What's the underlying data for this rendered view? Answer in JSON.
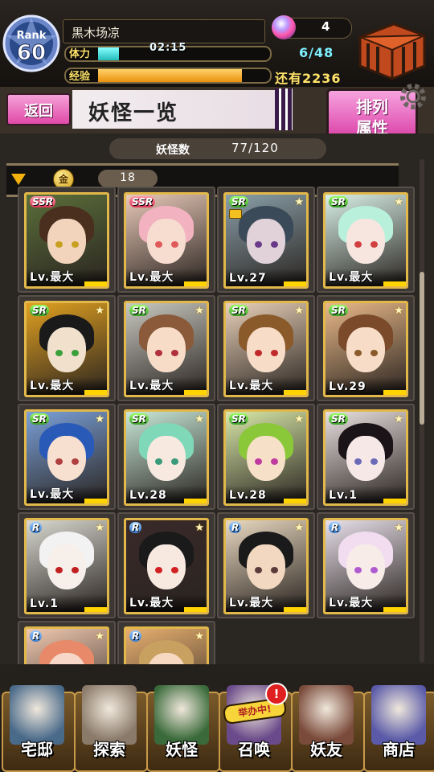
{
  "header": {
    "rank_label": "Rank",
    "rank_value": "60",
    "player_name": "黒木场凉",
    "stamina_label": "体力",
    "stamina_timer": "02:15",
    "stamina_value": "6/48",
    "stamina_fraction": 0.125,
    "exp_label": "经验",
    "exp_remaining": "还有2236",
    "exp_fraction": 0.87,
    "orb_count": "4"
  },
  "title_bar": {
    "back_label": "返回",
    "page_title": "妖怪一览",
    "sort_label_line1": "排列",
    "sort_label_line2": "属性"
  },
  "counts": {
    "label": "妖怪数",
    "value": "77/120",
    "coin_glyph": "金",
    "filter_count": "18"
  },
  "cards": [
    {
      "rarity": "SSR",
      "level": "Lv.最大",
      "hair": "#4a2f1f",
      "skin": "#f2d3bc",
      "eye": "#c8a020",
      "bg": "#5b6f3a",
      "locked": false
    },
    {
      "rarity": "SSR",
      "level": "Lv.最大",
      "hair": "#f2b2c0",
      "skin": "#f7dcd0",
      "eye": "#e05a5a",
      "bg": "#e8c9b8",
      "locked": false
    },
    {
      "rarity": "SR",
      "level": "Lv.27",
      "hair": "#3a4a58",
      "skin": "#e0d2d8",
      "eye": "#6a3a8a",
      "bg": "#8aa0aa",
      "locked": true
    },
    {
      "rarity": "SR",
      "level": "Lv.最大",
      "hair": "#b8f0dc",
      "skin": "#f7e6e0",
      "eye": "#d04040",
      "bg": "#d9f0e8",
      "locked": false
    },
    {
      "rarity": "SR",
      "level": "Lv.最大",
      "hair": "#1a1a1a",
      "skin": "#f0e0cc",
      "eye": "#3aa03a",
      "bg": "#e0a020",
      "locked": false
    },
    {
      "rarity": "SR",
      "level": "Lv.最大",
      "hair": "#8a5a3a",
      "skin": "#f7dcc8",
      "eye": "#b03040",
      "bg": "#c8c8c0",
      "locked": false
    },
    {
      "rarity": "SR",
      "level": "Lv.最大",
      "hair": "#8a5a2a",
      "skin": "#f7dcc8",
      "eye": "#c02a2a",
      "bg": "#e8d0b8",
      "locked": false
    },
    {
      "rarity": "SR",
      "level": "Lv.29",
      "hair": "#7a4a2a",
      "skin": "#f7dcc8",
      "eye": "#8a5a2a",
      "bg": "#e8b888",
      "locked": false
    },
    {
      "rarity": "SR",
      "level": "Lv.最大",
      "hair": "#2a5ab8",
      "skin": "#f7e0d0",
      "eye": "#b04040",
      "bg": "#7aa0d8",
      "locked": false
    },
    {
      "rarity": "SR",
      "level": "Lv.28",
      "hair": "#7fd8b8",
      "skin": "#f7e8e0",
      "eye": "#3a9a7a",
      "bg": "#c8e8d8",
      "locked": false
    },
    {
      "rarity": "SR",
      "level": "Lv.28",
      "hair": "#8ac83a",
      "skin": "#f7e0c8",
      "eye": "#c03aa0",
      "bg": "#d8e8a8",
      "locked": false
    },
    {
      "rarity": "SR",
      "level": "Lv.1",
      "hair": "#1a1418",
      "skin": "#f7e8e8",
      "eye": "#6a6ab8",
      "bg": "#e8e0e0",
      "locked": false
    },
    {
      "rarity": "R",
      "level": "Lv.1",
      "hair": "#f2f2f2",
      "skin": "#f7f0ea",
      "eye": "#c02020",
      "bg": "#d8d8d0",
      "locked": false
    },
    {
      "rarity": "R",
      "level": "Lv.最大",
      "hair": "#1a1a1a",
      "skin": "#f7e8e0",
      "eye": "#d02020",
      "bg": "#3a2a2a",
      "locked": false
    },
    {
      "rarity": "R",
      "level": "Lv.最大",
      "hair": "#1a1a1a",
      "skin": "#f2d8c0",
      "eye": "#5a3a3a",
      "bg": "#e8d8c0",
      "locked": false
    },
    {
      "rarity": "R",
      "level": "Lv.最大",
      "hair": "#f2dcf0",
      "skin": "#f7ece8",
      "eye": "#b05ad0",
      "bg": "#e8e0ea",
      "locked": false
    },
    {
      "rarity": "R",
      "level": "",
      "hair": "#e88a6a",
      "skin": "#f7d8c8",
      "eye": "#b04030",
      "bg": "#f0c8b0",
      "locked": false
    },
    {
      "rarity": "R",
      "level": "",
      "hair": "#c8a060",
      "skin": "#f7d8c0",
      "eye": "#7a4a2a",
      "bg": "#e8b070",
      "locked": false
    }
  ],
  "nav": [
    {
      "label": "宅邸",
      "icon": "mansion-icon",
      "color": "#4a6a8a"
    },
    {
      "label": "探索",
      "icon": "magnifier-icon",
      "color": "#8a7a6a"
    },
    {
      "label": "妖怪",
      "icon": "yokai-scroll-icon",
      "color": "#3a6a3a"
    },
    {
      "label": "召唤",
      "icon": "summon-icon",
      "color": "#6a4a8a"
    },
    {
      "label": "妖友",
      "icon": "friends-icon",
      "color": "#7a4a3a"
    },
    {
      "label": "商店",
      "icon": "shop-orb-icon",
      "color": "#5a5aa8"
    }
  ],
  "recruit_badge": "举办中!",
  "alert_glyph": "!"
}
